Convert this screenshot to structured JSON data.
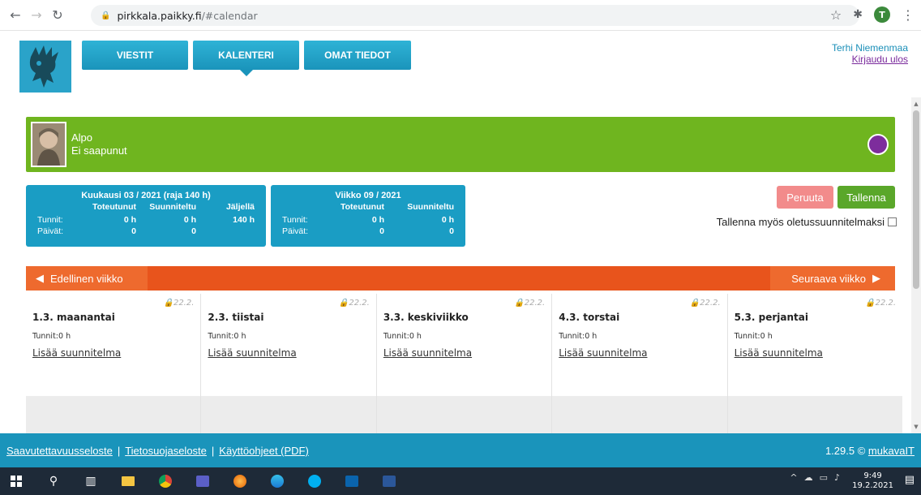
{
  "browser": {
    "url_host": "pirkkala.paikky.fi",
    "url_path": "/#calendar",
    "profile_initial": "T"
  },
  "header": {
    "tabs": [
      {
        "label": "VIESTIT"
      },
      {
        "label": "KALENTERI"
      },
      {
        "label": "OMAT TIEDOT"
      }
    ],
    "user_name": "Terhi Niemenmaa",
    "logout_label": "Kirjaudu ulos"
  },
  "child": {
    "name": "Alpo",
    "status": "Ei saapunut",
    "status_color": "#7d2d9c"
  },
  "month_card": {
    "title": "Kuukausi 03 / 2021 (raja 140 h)",
    "col_realized": "Toteutunut",
    "col_planned": "Suunniteltu",
    "col_remaining": "Jäljellä",
    "row_hours": "Tunnit:",
    "row_days": "Päivät:",
    "hours_realized": "0 h",
    "hours_planned": "0 h",
    "hours_remaining": "140 h",
    "days_realized": "0",
    "days_planned": "0"
  },
  "week_card": {
    "title": "Viikko 09 / 2021",
    "col_realized": "Toteutunut",
    "col_planned": "Suunniteltu",
    "row_hours": "Tunnit:",
    "row_days": "Päivät:",
    "hours_realized": "0 h",
    "hours_planned": "0 h",
    "days_realized": "0",
    "days_planned": "0"
  },
  "actions": {
    "cancel_label": "Peruuta",
    "save_label": "Tallenna",
    "save_default_label": "Tallenna myös oletussuunnitelmaksi"
  },
  "week_nav": {
    "prev_label": "Edellinen viikko",
    "next_label": "Seuraava viikko"
  },
  "days": [
    {
      "lock_date": "22.2.",
      "title": "1.3. maanantai",
      "hours_label": "Tunnit:",
      "hours": "0 h",
      "add_label": "Lisää suunnitelma"
    },
    {
      "lock_date": "22.2.",
      "title": "2.3. tiistai",
      "hours_label": "Tunnit:",
      "hours": "0 h",
      "add_label": "Lisää suunnitelma"
    },
    {
      "lock_date": "22.2.",
      "title": "3.3. keskiviikko",
      "hours_label": "Tunnit:",
      "hours": "0 h",
      "add_label": "Lisää suunnitelma"
    },
    {
      "lock_date": "22.2.",
      "title": "4.3. torstai",
      "hours_label": "Tunnit:",
      "hours": "0 h",
      "add_label": "Lisää suunnitelma"
    },
    {
      "lock_date": "22.2.",
      "title": "5.3. perjantai",
      "hours_label": "Tunnit:",
      "hours": "0 h",
      "add_label": "Lisää suunnitelma"
    }
  ],
  "footer": {
    "accessibility": "Saavutettavuusseloste",
    "privacy": "Tietosuojaseloste",
    "manual": "Käyttöohjeet (PDF)",
    "separator": "|",
    "version": "1.29.5 ©",
    "vendor": "mukavaIT"
  },
  "taskbar": {
    "time": "9:49",
    "date": "19.2.2021"
  }
}
